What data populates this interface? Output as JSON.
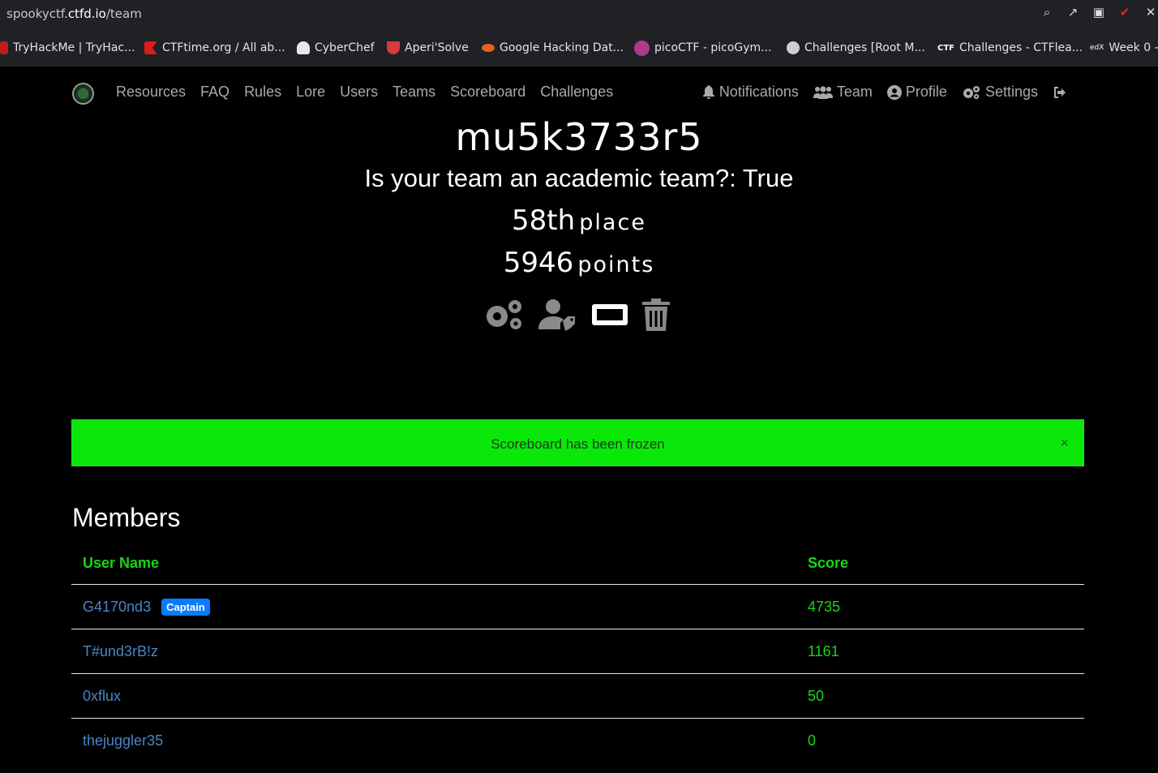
{
  "browser": {
    "url_prefix": "spookyctf.",
    "url_domain": "ctfd.io",
    "url_path": "/team",
    "bookmarks": [
      {
        "label": "TryHackMe | TryHac...",
        "color": "#c11c1c"
      },
      {
        "label": "CTFtime.org / All ab...",
        "color": "#e01b1b"
      },
      {
        "label": "CyberChef",
        "color": "#e8e8e8"
      },
      {
        "label": "Aperi'Solve",
        "color": "#d93a3a"
      },
      {
        "label": "Google Hacking Dat...",
        "color": "#e2621f"
      },
      {
        "label": "picoCTF - picoGym...",
        "color": "#b03a8c"
      },
      {
        "label": "Challenges [Root M...",
        "color": "#cfcfcf"
      },
      {
        "label": "Challenges - CTFlea...",
        "color": "#ffffff"
      },
      {
        "label": "Week 0 -",
        "color": "#ffffff"
      }
    ]
  },
  "nav": {
    "links": [
      "Resources",
      "FAQ",
      "Rules",
      "Lore",
      "Users",
      "Teams",
      "Scoreboard",
      "Challenges"
    ],
    "notifications": "Notifications",
    "team": "Team",
    "profile": "Profile",
    "settings": "Settings"
  },
  "team": {
    "name": "mu5k3733r5",
    "academic": "Is your team an academic team?: True",
    "place_value": "58th",
    "place_label": "place",
    "points_value": "5946",
    "points_label": "points"
  },
  "alert": {
    "message": "Scoreboard has been frozen",
    "close": "×",
    "color": "#0ae80a"
  },
  "members": {
    "title": "Members",
    "headers": {
      "user": "User Name",
      "score": "Score"
    },
    "rows": [
      {
        "name": "G4170nd3",
        "badge": "Captain",
        "score": "4735"
      },
      {
        "name": "T#und3rB!z",
        "badge": "",
        "score": "1161"
      },
      {
        "name": "0xflux",
        "badge": "",
        "score": "50"
      },
      {
        "name": "thejuggler35",
        "badge": "",
        "score": "0"
      }
    ]
  },
  "colors": {
    "accent_green": "#16d716",
    "link_blue": "#4a86c5",
    "badge_blue": "#0a7bff"
  }
}
